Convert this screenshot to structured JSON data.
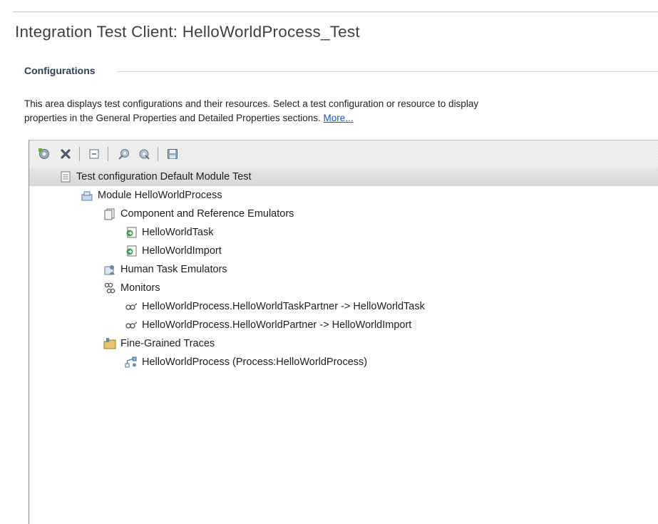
{
  "header": {
    "title": "Integration Test Client: HelloWorldProcess_Test"
  },
  "configurations": {
    "section_title": "Configurations",
    "description": "This area displays test configurations and their resources. Select a test configuration or resource to display",
    "description_line2": "properties in the General Properties and Detailed Properties sections.",
    "more_link": "More..."
  },
  "toolbar": {
    "buttons": [
      {
        "icon": "add-configuration-icon"
      },
      {
        "icon": "remove-icon"
      },
      {
        "icon": "collapse-all-icon"
      },
      {
        "icon": "run-icon"
      },
      {
        "icon": "stop-icon"
      },
      {
        "icon": "save-icon"
      }
    ]
  },
  "tree": {
    "items": [
      {
        "label": "Test configuration Default Module Test",
        "icon": "test-configuration-icon",
        "selected": true
      },
      {
        "label": "Module HelloWorldProcess",
        "icon": "module-icon"
      },
      {
        "label": "Component and Reference Emulators",
        "icon": "emulators-folder-icon"
      },
      {
        "label": "HelloWorldTask",
        "icon": "component-emulator-icon"
      },
      {
        "label": "HelloWorldImport",
        "icon": "component-emulator-icon"
      },
      {
        "label": "Human Task Emulators",
        "icon": "human-task-icon"
      },
      {
        "label": "Monitors",
        "icon": "monitors-icon"
      },
      {
        "label": "HelloWorldProcess.HelloWorldTaskPartner -> HelloWorldTask",
        "icon": "monitor-icon"
      },
      {
        "label": "HelloWorldProcess.HelloWorldPartner -> HelloWorldImport",
        "icon": "monitor-icon"
      },
      {
        "label": "Fine-Grained Traces",
        "icon": "traces-folder-icon"
      },
      {
        "label": "HelloWorldProcess (Process:HelloWorldProcess)",
        "icon": "process-icon"
      }
    ]
  },
  "colors": {
    "link": "#1155cc",
    "section_title": "#29415a",
    "selection": "#dcdcdc"
  }
}
